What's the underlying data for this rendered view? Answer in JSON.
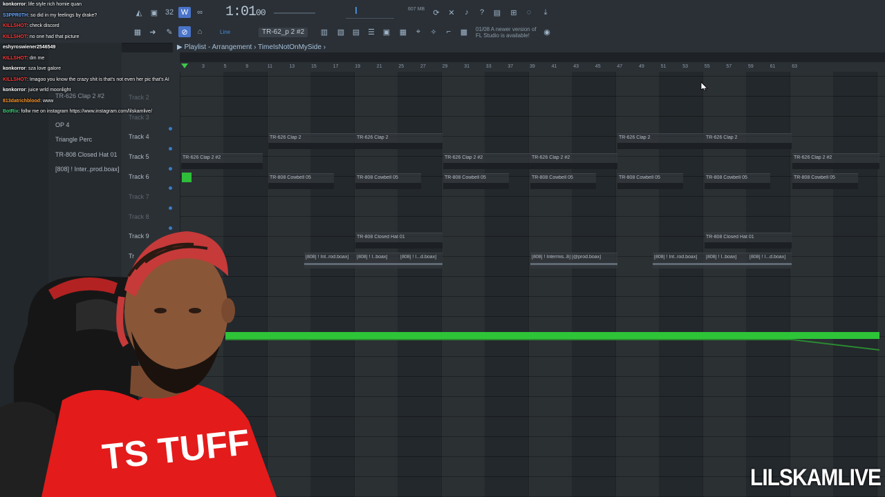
{
  "toolbar": {
    "time": "1:01",
    "time_ms": "00",
    "tempo_label": "32",
    "memory": "607 MB",
    "pattern": "TR-62_p 2 #2",
    "mode": "Line",
    "notice_line1": "01/08  A newer version of",
    "notice_line2": "FL Studio is available!"
  },
  "breadcrumb": {
    "title": "Playlist - Arrangement",
    "sep": "›",
    "song": "TimeIsNotOnMySide",
    "end": "›"
  },
  "browser": {
    "items": [
      "OP 4",
      "Triangle Perc",
      "TR-808 Closed Hat 01",
      "[808] ! Inter..prod.boax]"
    ],
    "extra": "TR-626 Clap 2 #2"
  },
  "ruler": {
    "numbers": [
      "3",
      "5",
      "9",
      "11",
      "13",
      "15",
      "17",
      "19",
      "21",
      "25",
      "27",
      "29",
      "31",
      "33",
      "37",
      "39",
      "41",
      "43",
      "45",
      "47",
      "49",
      "51",
      "53",
      "55",
      "57",
      "59",
      "61",
      "63"
    ]
  },
  "tracks": [
    {
      "name": "Track 2"
    },
    {
      "name": "Track 3"
    },
    {
      "name": "Track 4"
    },
    {
      "name": "Track 5"
    },
    {
      "name": "Track 6"
    },
    {
      "name": "Track 7"
    },
    {
      "name": "Track 8"
    },
    {
      "name": "Track 9"
    },
    {
      "name": "Tr"
    }
  ],
  "clips": {
    "clap2": "TR-626 Clap 2",
    "clap2b": "TR-626 Clap 2 #2",
    "cowbell": "TR-808 Cowbell 05",
    "hat": "TR-808 Closed Hat 01",
    "inter1": "[808] ! Int..rod.boax]",
    "inter2": "[808] ! I..boax]",
    "inter3": "[808] ! I...d.boax]",
    "inter4": "[808] ! Intermis..8] [@prod.boax]"
  },
  "chat": [
    {
      "user": "konkorror",
      "text": ": life style rich homie quan",
      "color": "#ffffff"
    },
    {
      "user": "S3PPR0TH",
      "text": ": so did in my feelings by drake?",
      "color": "#6aa8ff"
    },
    {
      "user": "KILLSHOT",
      "text": ": check discord",
      "color": "#ff3b3b"
    },
    {
      "user": "KILLSHOT",
      "text": ": no one had that picture",
      "color": "#ff3b3b"
    },
    {
      "user": "eshyroswiener2546549",
      "text": "",
      "color": "#ffffff"
    },
    {
      "user": "KILLSHOT",
      "text": ": dm me",
      "color": "#ff3b3b"
    },
    {
      "user": "konkorror",
      "text": ": sza love galore",
      "color": "#ffffff"
    },
    {
      "user": "KILLSHOT",
      "text": ": Imagoo you know the crazy shit is that's not even her pic that's AI",
      "color": "#ff3b3b"
    },
    {
      "user": "konkorror",
      "text": ": juice wrld moonlight",
      "color": "#ffffff"
    },
    {
      "user": "813datrichblood",
      "text": ": www",
      "color": "#ff9a2e"
    },
    {
      "user": "BotRix",
      "text": ": follw me on instagram https://www.instagram.com/lilskamlive/",
      "color": "#42d17a"
    }
  ],
  "overlay": {
    "shirt_text": "TS TUFF",
    "watermark": "LILSKAMLIVE"
  },
  "colors": {
    "accent": "#4a74c9",
    "automation": "#2ec438",
    "background": "#23282c"
  }
}
